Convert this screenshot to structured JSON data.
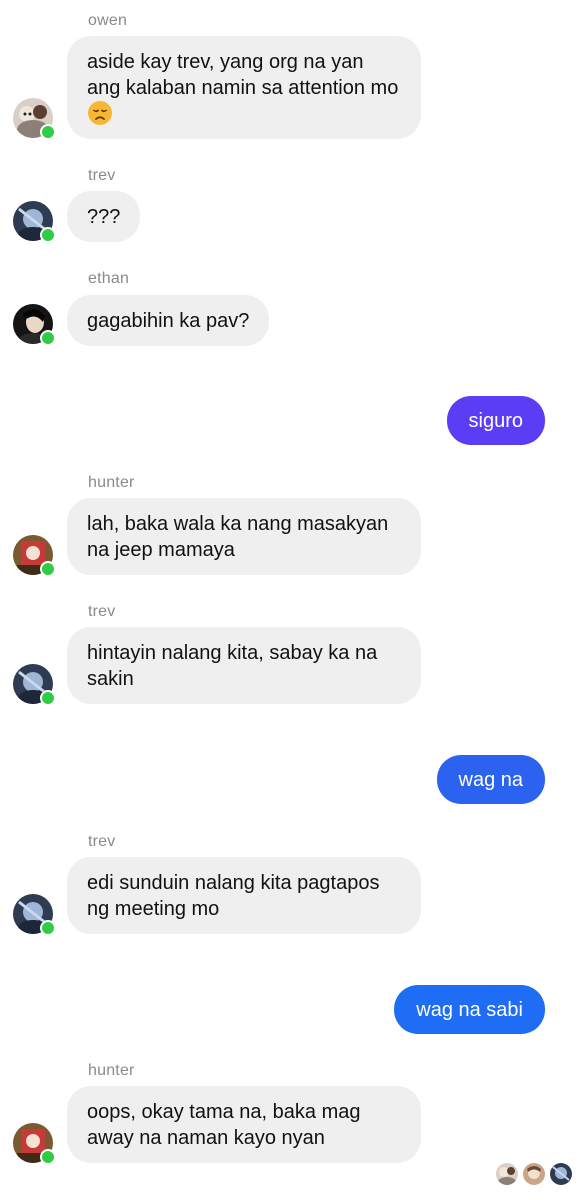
{
  "messages": [
    {
      "sender": "owen",
      "text": "aside kay trev, yang org na yan ang kalaban namin sa attention mo",
      "emoji": "disappointed-face-emoji"
    },
    {
      "sender": "trev",
      "text": "???"
    },
    {
      "sender": "ethan",
      "text": "gagabihin ka pav?"
    },
    {
      "self": true,
      "text": "siguro",
      "color": "#5b3df5"
    },
    {
      "sender": "hunter",
      "text": "lah, baka wala ka nang masakyan na jeep mamaya"
    },
    {
      "sender": "trev",
      "text": "hintayin nalang kita, sabay ka na sakin"
    },
    {
      "self": true,
      "text": "wag na",
      "color": "#2b63f0"
    },
    {
      "sender": "trev",
      "text": "edi sunduin nalang kita pagtapos ng meeting mo"
    },
    {
      "self": true,
      "text": "wag na sabi",
      "color": "#1f6cf5"
    },
    {
      "sender": "hunter",
      "text": "oops, okay tama na, baka mag away na naman kayo nyan"
    }
  ],
  "colors": {
    "incoming_bubble": "#efefef",
    "online": "#31cc46",
    "sender_label": "#8a8a8a"
  }
}
